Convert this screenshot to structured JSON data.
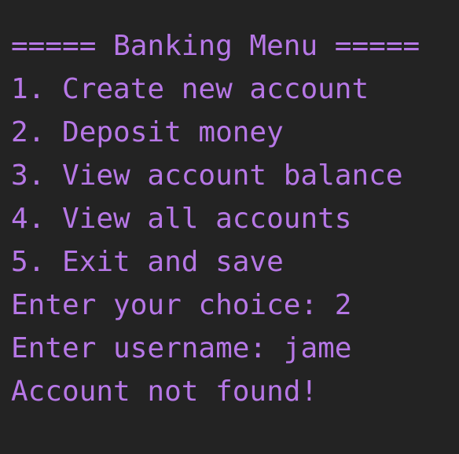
{
  "theme": {
    "background": "#232323",
    "text_color": "#b677e6"
  },
  "terminal": {
    "lines": [
      "===== Banking Menu =====",
      "1. Create new account",
      "2. Deposit money",
      "3. View account balance",
      "4. View all accounts",
      "5. Exit and save",
      "Enter your choice: 2",
      "Enter username: jame",
      "Account not found!"
    ]
  }
}
